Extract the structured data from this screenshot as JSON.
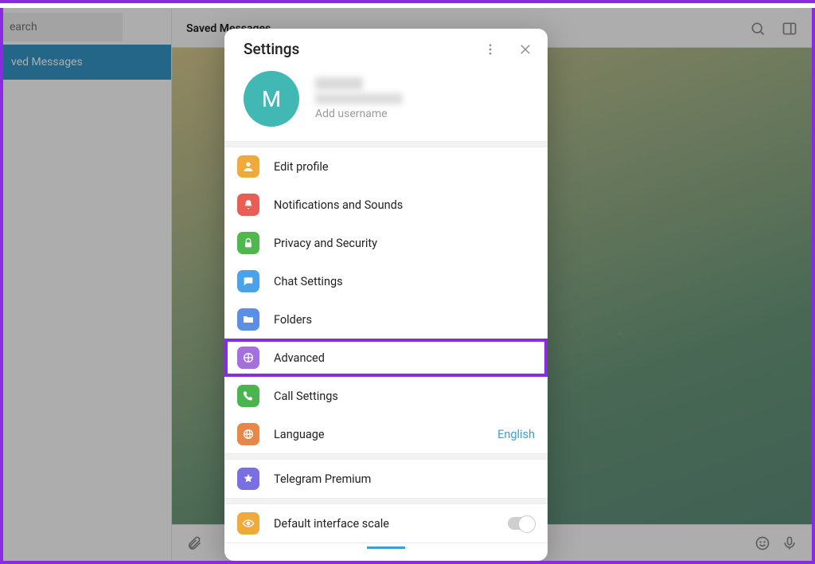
{
  "sidebar": {
    "search_placeholder": "earch",
    "chats": [
      {
        "label": "ved Messages"
      }
    ]
  },
  "main": {
    "title": "Saved Messages"
  },
  "modal": {
    "title": "Settings",
    "profile": {
      "avatar_initial": "M",
      "add_username_label": "Add username"
    },
    "items": [
      {
        "icon": "edit",
        "label": "Edit profile"
      },
      {
        "icon": "notif",
        "label": "Notifications and Sounds"
      },
      {
        "icon": "priv",
        "label": "Privacy and Security"
      },
      {
        "icon": "chat",
        "label": "Chat Settings"
      },
      {
        "icon": "fold",
        "label": "Folders"
      },
      {
        "icon": "adv",
        "label": "Advanced",
        "highlight": true
      },
      {
        "icon": "call",
        "label": "Call Settings"
      },
      {
        "icon": "lang",
        "label": "Language",
        "value": "English"
      }
    ],
    "premium_label": "Telegram Premium",
    "scale_label": "Default interface scale"
  }
}
